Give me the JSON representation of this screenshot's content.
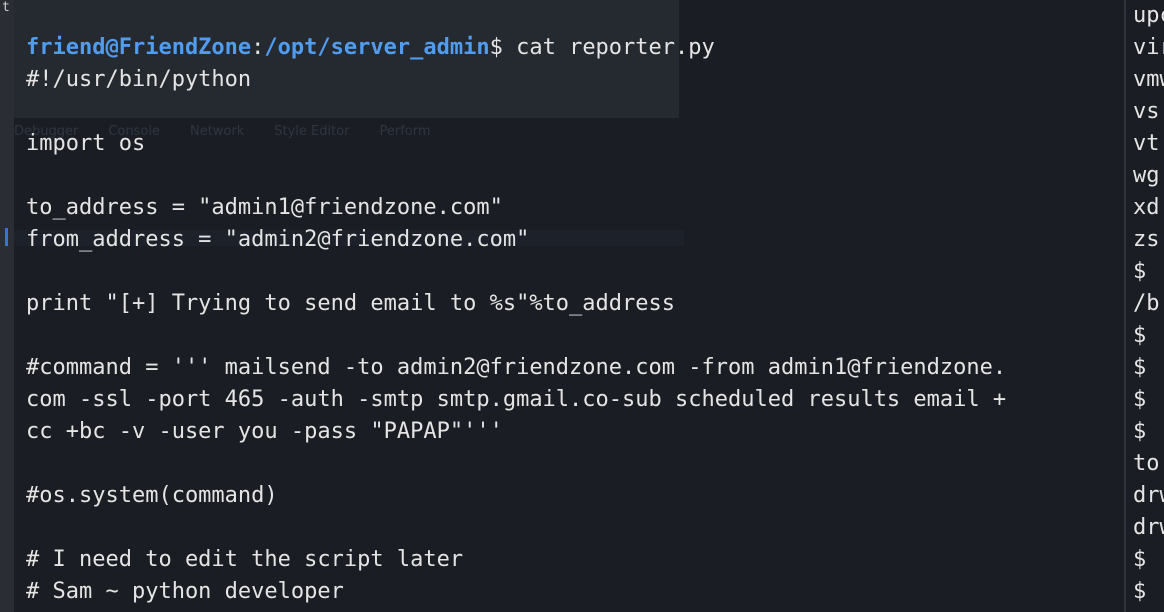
{
  "left_edge_mark": "t",
  "devtools_ghost": {
    "tabs": [
      "Debugger",
      "Console",
      "Network",
      "Style Editor",
      "Perform"
    ]
  },
  "terminal": {
    "prompt": {
      "user_host": "friend@FriendZone",
      "colon": ":",
      "path": "/opt/server_admin",
      "dollar": "$",
      "command": " cat reporter.py"
    },
    "lines": [
      "#!/usr/bin/python",
      "",
      "import os",
      "",
      "to_address = \"admin1@friendzone.com\"",
      "from_address = \"admin2@friendzone.com\"",
      "",
      "print \"[+] Trying to send email to %s\"%to_address",
      "",
      "#command = ''' mailsend -to admin2@friendzone.com -from admin1@friendzone.",
      "com -ssl -port 465 -auth -smtp smtp.gmail.co-sub scheduled results email +",
      "cc +bc -v -user you -pass \"PAPAP\"'''",
      "",
      "#os.system(command)",
      "",
      "# I need to edit the script later",
      "# Sam ~ python developer"
    ]
  },
  "right_pane": {
    "lines": [
      "upc",
      "vir",
      "vmw",
      "vs",
      "vt",
      "wg",
      "xd",
      "zs",
      "$",
      "/b",
      "$",
      "$",
      "$",
      "$",
      "to",
      "drw",
      "drw",
      "$",
      "$"
    ]
  }
}
